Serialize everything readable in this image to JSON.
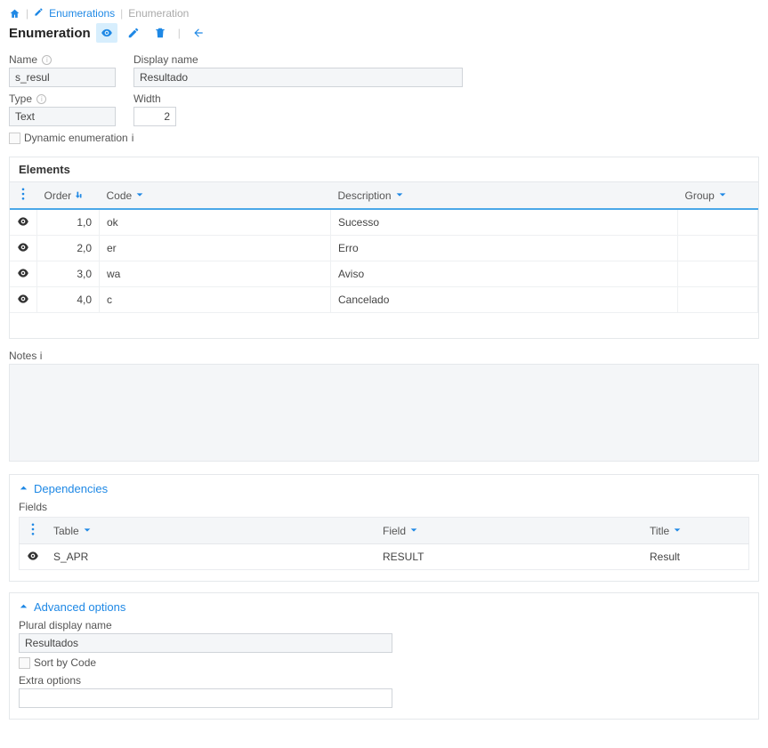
{
  "breadcrumb": {
    "enumerations": "Enumerations",
    "current": "Enumeration"
  },
  "header": {
    "title": "Enumeration"
  },
  "form": {
    "name_label": "Name",
    "name_value": "s_resul",
    "display_label": "Display name",
    "display_value": "Resultado",
    "type_label": "Type",
    "type_value": "Text",
    "width_label": "Width",
    "width_value": "2",
    "dynamic_label": "Dynamic enumeration"
  },
  "elements": {
    "title": "Elements",
    "cols": {
      "order": "Order",
      "code": "Code",
      "desc": "Description",
      "group": "Group"
    },
    "rows": [
      {
        "order": "1,0",
        "code": "ok",
        "desc": "Sucesso",
        "group": ""
      },
      {
        "order": "2,0",
        "code": "er",
        "desc": "Erro",
        "group": ""
      },
      {
        "order": "3,0",
        "code": "wa",
        "desc": "Aviso",
        "group": ""
      },
      {
        "order": "4,0",
        "code": "c",
        "desc": "Cancelado",
        "group": ""
      }
    ]
  },
  "notes": {
    "label": "Notes"
  },
  "deps": {
    "title": "Dependencies",
    "fields_label": "Fields",
    "cols": {
      "table": "Table",
      "field": "Field",
      "title_c": "Title"
    },
    "rows": [
      {
        "table": "S_APR",
        "field": "RESULT",
        "title": "Result"
      }
    ]
  },
  "adv": {
    "title": "Advanced options",
    "plural_label": "Plural display name",
    "plural_value": "Resultados",
    "sort_label": "Sort by Code",
    "extra_label": "Extra options",
    "extra_value": ""
  }
}
